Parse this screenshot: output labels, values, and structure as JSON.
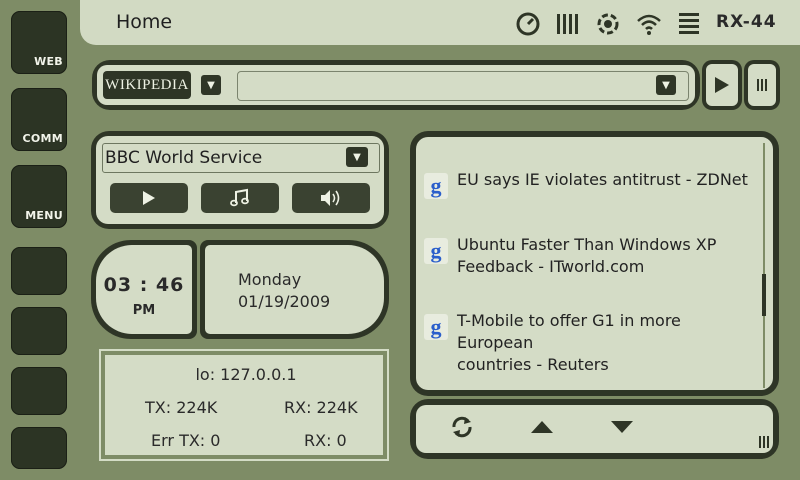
{
  "dock": {
    "web_label": "WEB",
    "comm_label": "COMM",
    "menu_label": "MENU"
  },
  "topbar": {
    "title": "Home",
    "model": "RX-44",
    "status_icons": [
      "clock-icon",
      "battery-bars-icon",
      "radio-icon",
      "wifi-icon",
      "signal-stack-icon"
    ]
  },
  "search": {
    "engine_logo": "WIKIPEDIA",
    "query": ""
  },
  "radio": {
    "station": "BBC World Service"
  },
  "clock": {
    "time": "03 : 46",
    "ampm": "PM",
    "day": "Monday",
    "date": "01/19/2009"
  },
  "network": {
    "lo": "lo: 127.0.0.1",
    "tx": "TX: 224K",
    "rx": "RX: 224K",
    "err_tx": "Err TX: 0",
    "err_rx": "RX: 0"
  },
  "news": {
    "items": [
      {
        "line1": "EU says IE violates antitrust - ZDNet",
        "line2": ""
      },
      {
        "line1": "Ubuntu Faster Than Windows XP",
        "line2": "Feedback - ITworld.com"
      },
      {
        "line1": "T-Mobile to offer G1 in more European",
        "line2": "countries - Reuters"
      }
    ]
  },
  "colors": {
    "background": "#7e8c66",
    "panel_dark": "#2e3526",
    "panel_light": "#d4dcc6",
    "dock": "#2c3424"
  }
}
